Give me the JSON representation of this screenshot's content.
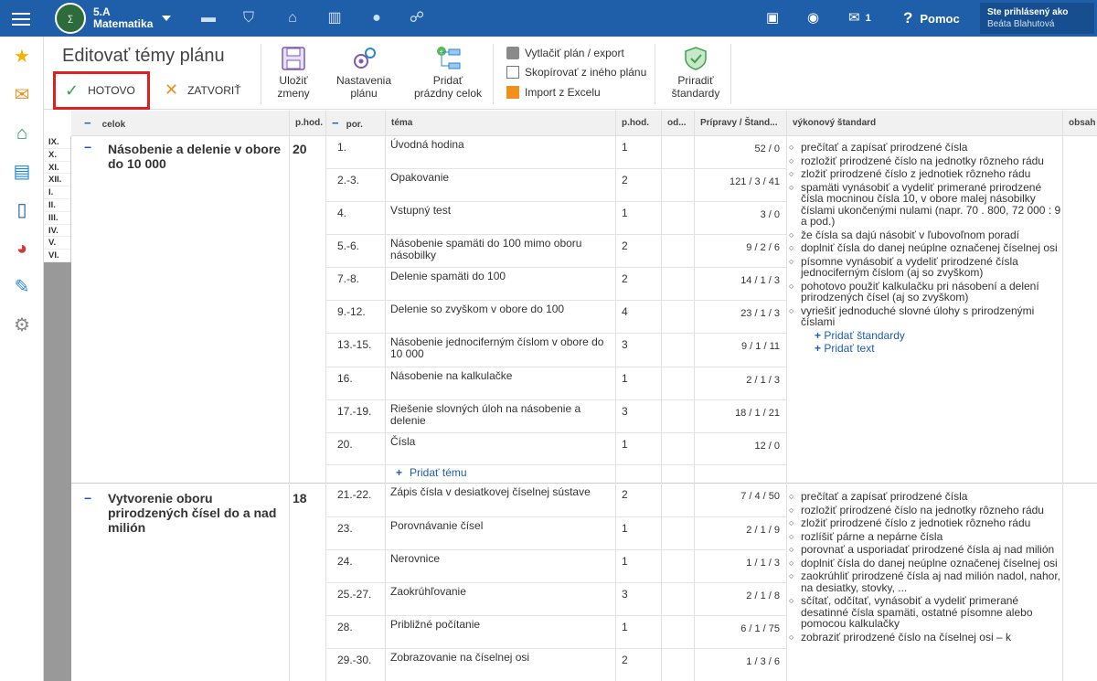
{
  "topbar": {
    "class_name": "5.A",
    "subject": "Matematika",
    "messages_count": "1",
    "help_label": "Pomoc",
    "user_prefix": "Ste prihlásený ako",
    "user_name": "Beáta Blahutová",
    "colors": {
      "bar": "#1f5ea8",
      "user_box": "#174e90"
    }
  },
  "toolbar": {
    "title": "Editovať témy plánu",
    "done_label": "HOTOVO",
    "close_label": "ZATVORIŤ",
    "save_label_1": "Uložiť",
    "save_label_2": "zmeny",
    "settings_label_1": "Nastavenia",
    "settings_label_2": "plánu",
    "add_unit_label_1": "Pridať",
    "add_unit_label_2": "prázdny celok",
    "print_label": "Vytlačiť plán / export",
    "copy_label": "Skopírovať z iného plánu",
    "import_label": "Import z Excelu",
    "assign_label_1": "Priradiť",
    "assign_label_2": "štandardy"
  },
  "table_header": {
    "celok": "celok",
    "phod": "p.hod.",
    "por": "por.",
    "tema": "téma",
    "phod2": "p.hod.",
    "od": "od...",
    "pripravy": "Prípravy / Štand...",
    "vykonovy": "výkonový štandard",
    "obsah": "obsah"
  },
  "months": [
    "IX.",
    "X.",
    "XI.",
    "XII.",
    "I.",
    "II.",
    "III.",
    "IV.",
    "V.",
    "VI."
  ],
  "units": [
    {
      "title": "Násobenie a delenie v obore do 10 000",
      "hours": "20",
      "rows": [
        {
          "por": "1.",
          "tema": "Úvodná hodina",
          "hod": "1",
          "pr": "52 / 0"
        },
        {
          "por": "2.-3.",
          "tema": "Opakovanie",
          "hod": "2",
          "pr": "121 / 3 / 41"
        },
        {
          "por": "4.",
          "tema": "Vstupný test",
          "hod": "1",
          "pr": "3 / 0"
        },
        {
          "por": "5.-6.",
          "tema": "Násobenie spamäti do 100 mimo oboru násobilky",
          "hod": "2",
          "pr": "9 / 2 / 6"
        },
        {
          "por": "7.-8.",
          "tema": "Delenie spamäti do 100",
          "hod": "2",
          "pr": "14 / 1 / 3"
        },
        {
          "por": "9.-12.",
          "tema": "Delenie so zvyškom v obore do 100",
          "hod": "4",
          "pr": "23 / 1 / 3"
        },
        {
          "por": "13.-15.",
          "tema": "Násobenie jednociferným číslom v obore do 10 000",
          "hod": "3",
          "pr": "9 / 1 / 11"
        },
        {
          "por": "16.",
          "tema": "Násobenie na kalkulačke",
          "hod": "1",
          "pr": "2 / 1 / 3"
        },
        {
          "por": "17.-19.",
          "tema": "Riešenie slovných úloh na násobenie a delenie",
          "hod": "3",
          "pr": "18 / 1 / 21"
        },
        {
          "por": "20.",
          "tema": "Čísla",
          "hod": "1",
          "pr": "12 / 0"
        }
      ],
      "add_tema": "Pridať tému",
      "standards": [
        "prečítať a zapísať prirodzené čísla",
        "rozložiť prirodzené číslo na jednotky rôzneho rádu",
        "zložiť prirodzené číslo z jednotiek rôzneho rádu",
        "spamäti vynásobiť a vydeliť primerané prirodzené čísla mocninou čísla 10, v obore malej násobilky číslami ukončenými nulami (napr. 70 . 800, 72 000 : 9 a pod.)",
        "že čísla sa dajú násobiť v ľubovoľnom poradí",
        "doplniť čísla do danej neúplne označenej číselnej osi",
        "písomne vynásobiť a vydeliť prirodzené čísla jednociferným číslom (aj so zvyškom)",
        "pohotovo použiť kalkulačku pri násobení a delení prirodzených čísel (aj so zvyškom)",
        "vyriešiť jednoduché slovné úlohy s prirodzenými číslami"
      ],
      "add_standards": "Pridať štandardy",
      "add_text": "Pridať text"
    },
    {
      "title": "Vytvorenie oboru prirodzených čísel do a nad milión",
      "hours": "18",
      "rows": [
        {
          "por": "21.-22.",
          "tema": "Zápis čísla v desiatkovej číselnej sústave",
          "hod": "2",
          "pr": "7 / 4 / 50"
        },
        {
          "por": "23.",
          "tema": "Porovnávanie čísel",
          "hod": "1",
          "pr": "2 / 1 / 9"
        },
        {
          "por": "24.",
          "tema": "Nerovnice",
          "hod": "1",
          "pr": "1 / 1 / 3"
        },
        {
          "por": "25.-27.",
          "tema": "Zaokrúhľovanie",
          "hod": "3",
          "pr": "2 / 1 / 8"
        },
        {
          "por": "28.",
          "tema": "Približné počítanie",
          "hod": "1",
          "pr": "6 / 1 / 75"
        },
        {
          "por": "29.-30.",
          "tema": "Zobrazovanie na číselnej osi",
          "hod": "2",
          "pr": "1 / 3 / 6"
        }
      ],
      "standards": [
        "prečítať a zapísať prirodzené čísla",
        "rozložiť prirodzené číslo na jednotky rôzneho rádu",
        "zložiť prirodzené číslo z jednotiek rôzneho rádu",
        "rozlíšiť párne a nepárne čísla",
        "porovnať a usporiadať prirodzené čísla aj nad milión",
        "doplniť čísla do danej neúplne označenej číselnej osi",
        "zaokrúhliť prirodzené čísla aj nad milión nadol, nahor, na desiatky, stovky, ...",
        "sčítať, odčítať, vynásobiť a vydeliť primerané desatinné čísla spamäti, ostatné písomne alebo pomocou kalkulačky",
        "zobraziť prirodzené číslo na číselnej osi – k"
      ]
    }
  ]
}
